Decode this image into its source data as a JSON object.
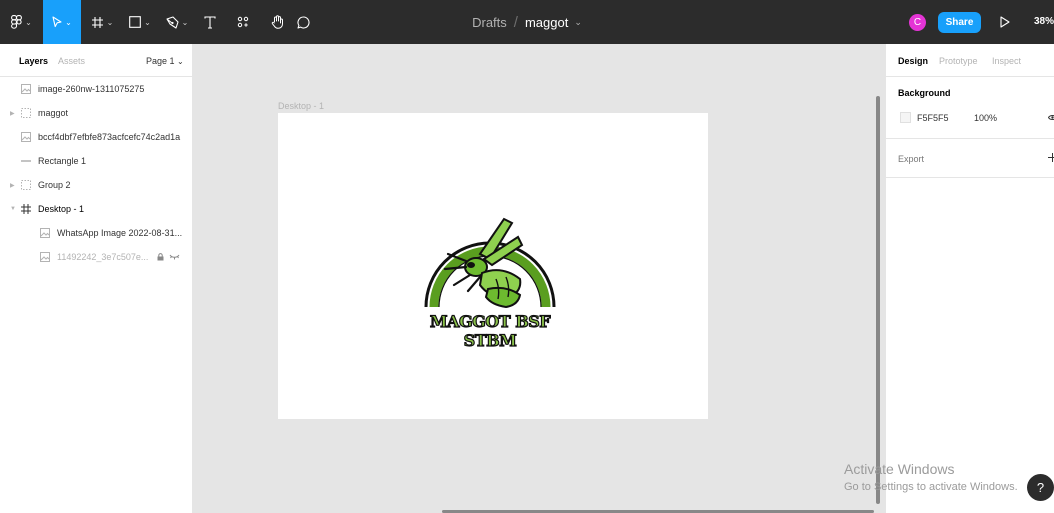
{
  "toolbar": {
    "breadcrumb_drafts": "Drafts",
    "breadcrumb_sep": "/",
    "file_name": "maggot",
    "avatar_initial": "C",
    "share_label": "Share",
    "zoom": "38%",
    "accent_color": "#18a0fb",
    "icons": [
      "figma-menu-icon",
      "move-tool-icon",
      "frame-tool-icon",
      "shape-tool-icon",
      "pen-tool-icon",
      "text-tool-icon",
      "resources-icon",
      "hand-tool-icon",
      "comment-tool-icon",
      "play-icon"
    ]
  },
  "left_panel": {
    "tab_layers": "Layers",
    "tab_assets": "Assets",
    "page_label": "Page 1",
    "layers": [
      {
        "label": "image-260nw-1311075275",
        "type": "image"
      },
      {
        "label": "maggot",
        "type": "group"
      },
      {
        "label": "bccf4dbf7efbfe873acfcefc74c2ad1a",
        "type": "image"
      },
      {
        "label": "Rectangle 1",
        "type": "rectangle"
      },
      {
        "label": "Group 2",
        "type": "group"
      },
      {
        "label": "Desktop - 1",
        "type": "frame"
      },
      {
        "label": "WhatsApp Image 2022-08-31...",
        "type": "image"
      },
      {
        "label": "11492242_3e7c507e...",
        "type": "image"
      }
    ]
  },
  "canvas": {
    "frame_label": "Desktop - 1",
    "logo_text": "MAGGOT BSF STBM"
  },
  "right_panel": {
    "tab_design": "Design",
    "tab_prototype": "Prototype",
    "tab_inspect": "Inspect",
    "background_title": "Background",
    "background_hex": "F5F5F5",
    "background_opacity": "100%",
    "export_title": "Export"
  },
  "overlay": {
    "activate_title": "Activate Windows",
    "activate_sub": "Go to Settings to activate Windows.",
    "help": "?"
  }
}
